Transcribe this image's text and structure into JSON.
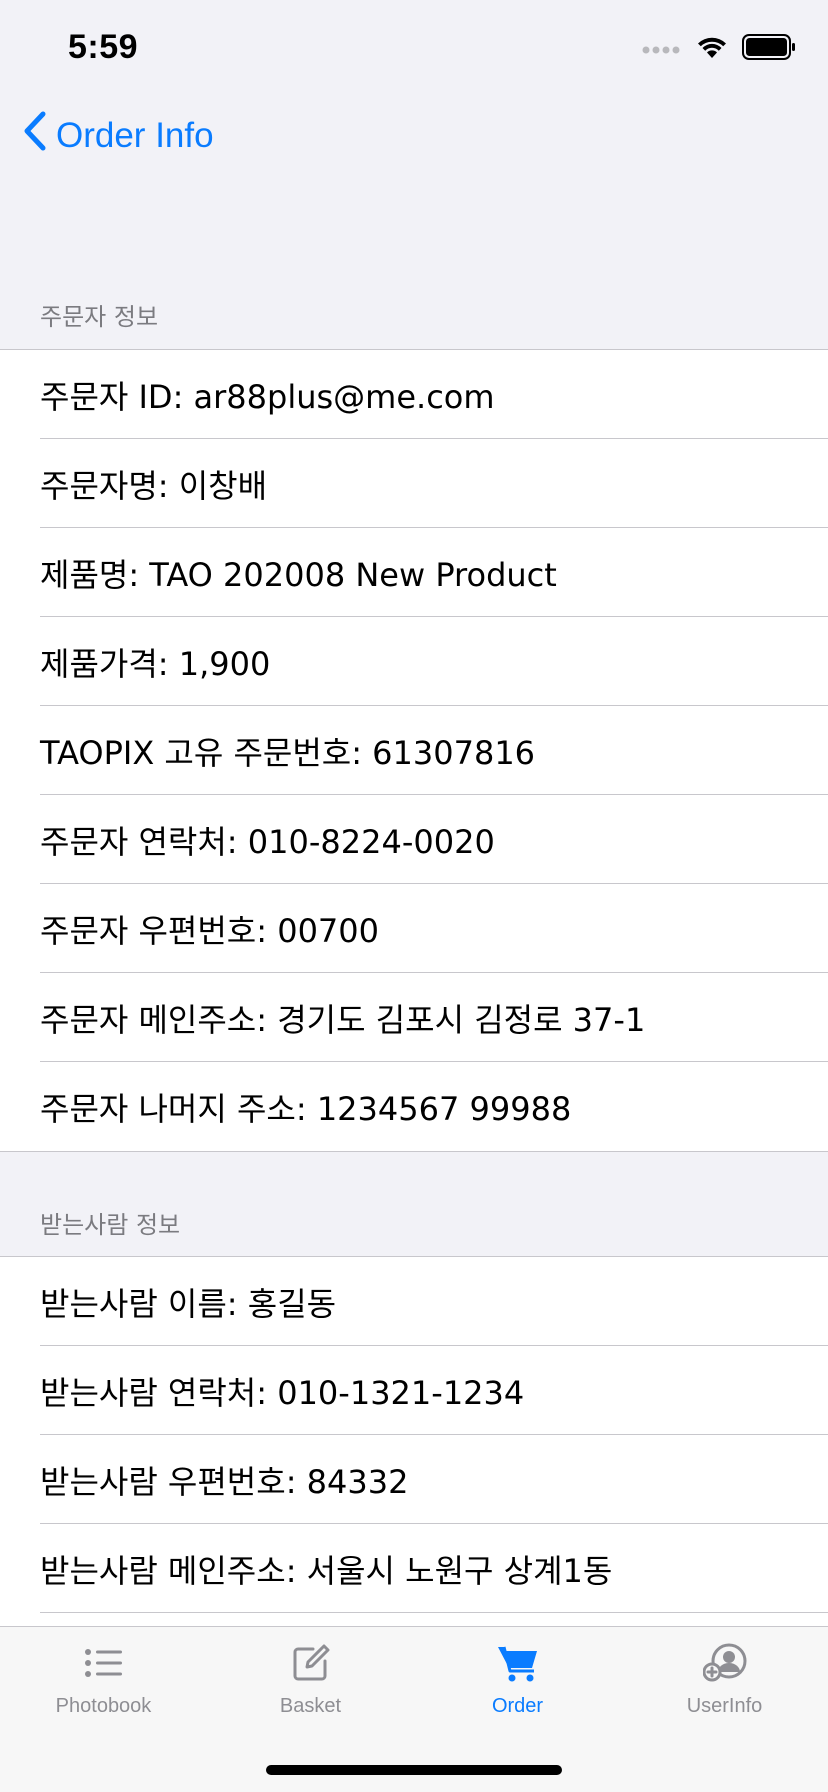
{
  "status_bar": {
    "time": "5:59",
    "icons": [
      "cellular-signal-icon",
      "wifi-icon",
      "battery-icon"
    ]
  },
  "nav": {
    "back_label": "Order Info",
    "back_icon": "chevron-left-icon"
  },
  "sections": [
    {
      "header": "주문자 정보",
      "rows": [
        "주문자 ID: ar88plus@me.com",
        "주문자명: 이창배",
        "제품명: TAO 202008 New Product",
        "제품가격: 1,900",
        "TAOPIX 고유 주문번호: 61307816",
        "주문자 연락처: 010-8224-0020",
        "주문자 우편번호: 00700",
        "주문자 메인주소: 경기도 김포시 김정로 37-1",
        "주문자 나머지 주소: 1234567 99988"
      ]
    },
    {
      "header": "받는사람 정보",
      "rows": [
        "받는사람 이름: 홍길동",
        "받는사람 연락처: 010-1321-1234",
        "받는사람 우편번호: 84332",
        "받는사람 메인주소: 서울시 노원구 상계1동"
      ]
    }
  ],
  "tab_bar": {
    "active_index": 2,
    "tabs": [
      {
        "label": "Photobook",
        "icon": "list-icon"
      },
      {
        "label": "Basket",
        "icon": "edit-icon"
      },
      {
        "label": "Order",
        "icon": "cart-icon"
      },
      {
        "label": "UserInfo",
        "icon": "add-user-icon"
      }
    ]
  },
  "colors": {
    "accent": "#0a7cff",
    "background": "#f2f2f7",
    "inactive_tab": "#8e8e93",
    "separator": "#c8c7cc"
  }
}
